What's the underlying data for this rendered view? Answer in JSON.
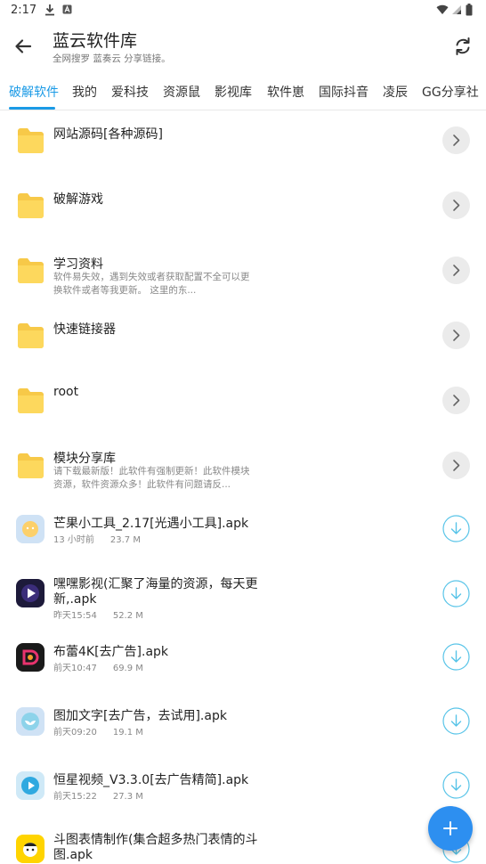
{
  "status_bar": {
    "time": "2:17"
  },
  "app_bar": {
    "title": "蓝云软件库",
    "subtitle": "全网搜罗 蓝奏云 分享链接。"
  },
  "tabs": [
    {
      "label": "破解软件",
      "active": true
    },
    {
      "label": "我的"
    },
    {
      "label": "爱科技"
    },
    {
      "label": "资源鼠"
    },
    {
      "label": "影视库"
    },
    {
      "label": "软件崽"
    },
    {
      "label": "国际抖音"
    },
    {
      "label": "凌辰"
    },
    {
      "label": "GG分享社"
    }
  ],
  "folders": [
    {
      "name": "网站源码[各种源码]",
      "desc": ""
    },
    {
      "name": "破解游戏",
      "desc": ""
    },
    {
      "name": "学习资料",
      "desc": "软件易失效，遇到失效或者获取配置不全可以更换软件或者等我更新。 这里的东..."
    },
    {
      "name": "快速链接器",
      "desc": ""
    },
    {
      "name": "root",
      "desc": ""
    },
    {
      "name": "模块分享库",
      "desc": "请下载最新版！此软件有强制更新！此软件模块资源，软件资源众多！此软件有问题请反..."
    }
  ],
  "files": [
    {
      "name": "芒果小工具_2.17[光遇小工具].apk",
      "time": "13 小时前",
      "size": "23.7 M",
      "icon": "mango-app-icon"
    },
    {
      "name": "嘿嘿影视(汇聚了海量的资源，每天更新,.apk",
      "time": "昨天15:54",
      "size": "52.2 M",
      "icon": "play-app-icon"
    },
    {
      "name": "布蕾4K[去广告].apk",
      "time": "前天10:47",
      "size": "69.9 M",
      "icon": "d-app-icon"
    },
    {
      "name": "图加文字[去广告，去试用].apk",
      "time": "前天09:20",
      "size": "19.1 M",
      "icon": "bird-app-icon"
    },
    {
      "name": "恒星视频_V3.3.0[去广告精简].apk",
      "time": "前天15:22",
      "size": "27.3 M",
      "icon": "star-video-app-icon"
    },
    {
      "name": "斗图表情制作(集合超多热门表情的斗图.apk",
      "time": "",
      "size": "",
      "icon": "meme-app-icon"
    }
  ],
  "colors": {
    "accent": "#1a9ae6",
    "folder": "#fdd85d",
    "fab": "#2d8ff0"
  }
}
